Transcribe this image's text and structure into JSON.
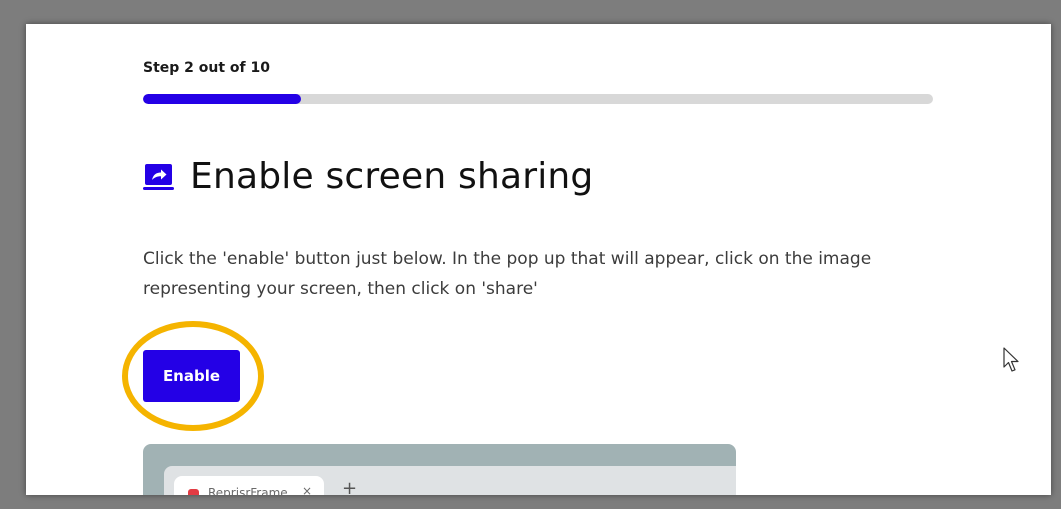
{
  "step": {
    "label": "Step 2 out of 10",
    "current": 2,
    "total": 10,
    "progress_fraction": 0.2
  },
  "heading": {
    "icon": "screen-share-icon",
    "title": "Enable screen sharing"
  },
  "instructions": "Click the 'enable' button just below. In the pop up that will appear, click on the image representing your screen, then click on 'share'",
  "enable_button": {
    "label": "Enable"
  },
  "preview": {
    "tab_label": "ReprisrFrame",
    "tab_close": "×",
    "new_tab": "+"
  },
  "colors": {
    "accent": "#2400e6",
    "highlight": "#f5b400",
    "track": "#d8d8d8"
  }
}
